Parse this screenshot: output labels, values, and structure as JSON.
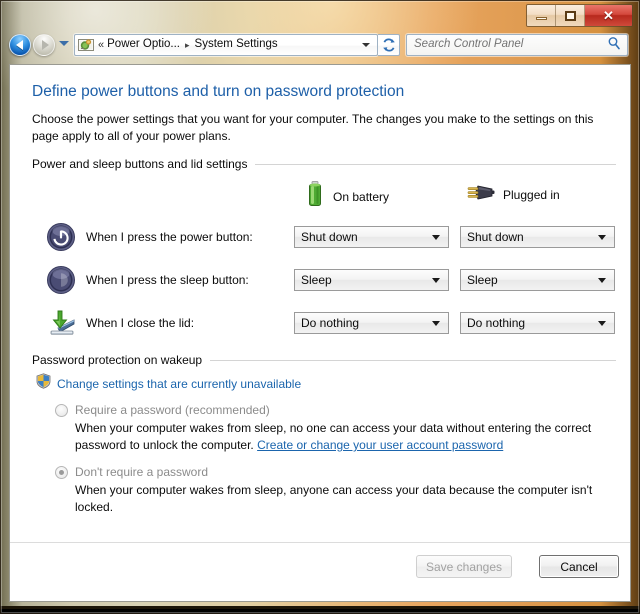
{
  "window": {
    "caption": {
      "minimize_icon": "minimize-icon",
      "maximize_icon": "maximize-icon",
      "close_glyph": "✕"
    }
  },
  "navbar": {
    "back_icon": "back-arrow-icon",
    "forward_icon": "forward-arrow-icon",
    "history_icon": "chevron-down-icon",
    "address": {
      "icon": "control-panel-icon",
      "overflow_chevrons": "«",
      "crumbs": [
        {
          "label": "Power Optio...",
          "sep": "▸"
        },
        {
          "label": "System Settings",
          "sep": ""
        }
      ],
      "dropdown_icon": "chevron-down-icon"
    },
    "refresh_icon": "refresh-icon",
    "search": {
      "placeholder": "Search Control Panel",
      "icon": "search-icon"
    }
  },
  "page": {
    "title": "Define power buttons and turn on password protection",
    "description": "Choose the power settings that you want for your computer. The changes you make to the settings on this page apply to all of your power plans."
  },
  "power_section": {
    "heading": "Power and sleep buttons and lid settings",
    "columns": [
      {
        "label": "On battery",
        "icon": "battery-icon"
      },
      {
        "label": "Plugged in",
        "icon": "power-plug-icon"
      }
    ],
    "rows": [
      {
        "icon": "power-button-icon",
        "label": "When I press the power button:",
        "on_battery": "Shut down",
        "plugged_in": "Shut down"
      },
      {
        "icon": "sleep-button-icon",
        "label": "When I press the sleep button:",
        "on_battery": "Sleep",
        "plugged_in": "Sleep"
      },
      {
        "icon": "close-lid-icon",
        "label": "When I close the lid:",
        "on_battery": "Do nothing",
        "plugged_in": "Do nothing"
      }
    ],
    "dropdown_arrow_icon": "chevron-down-icon"
  },
  "password_section": {
    "heading": "Password protection on wakeup",
    "change_settings": {
      "icon": "uac-shield-icon",
      "text": "Change settings that are currently unavailable"
    },
    "options": [
      {
        "label": "Require a password (recommended)",
        "selected": false,
        "description_before": "When your computer wakes from sleep, no one can access your data without entering the correct password to unlock the computer. ",
        "link": "Create or change your user account password",
        "description_after": ""
      },
      {
        "label": "Don't require a password",
        "selected": true,
        "description_before": "When your computer wakes from sleep, anyone can access your data because the computer isn't locked.",
        "link": "",
        "description_after": ""
      }
    ]
  },
  "footer": {
    "save_label": "Save changes",
    "cancel_label": "Cancel"
  },
  "colors": {
    "link": "#1b65ad",
    "title": "#1d5fa8",
    "disabled_text": "#8b8b8b",
    "close_button": "#c0392b"
  }
}
